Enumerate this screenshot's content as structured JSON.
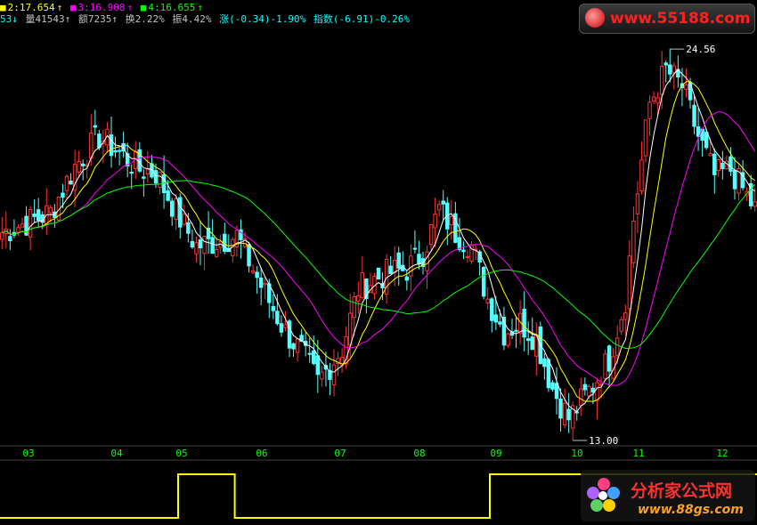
{
  "header": {
    "ma_line": [
      {
        "label": "2:17.654",
        "arrow": "↑",
        "color": "#ffff00"
      },
      {
        "label": "3:16.908",
        "arrow": "↑",
        "color": "#ff00ff"
      },
      {
        "label": "4:16.655",
        "arrow": "↑",
        "color": "#00ff00"
      }
    ],
    "info_line": [
      {
        "text": "53↓",
        "color": "#00ffff"
      },
      {
        "text": "量41543↑",
        "color": "#c0c0c0"
      },
      {
        "text": "额7235↑",
        "color": "#c0c0c0"
      },
      {
        "text": "换2.22%",
        "color": "#c0c0c0"
      },
      {
        "text": "振4.42%",
        "color": "#c0c0c0"
      },
      {
        "text": "涨(-0.34)-1.90%",
        "color": "#00ffff"
      },
      {
        "text": "指数(-6.91)-0.26%",
        "color": "#00ffff"
      }
    ]
  },
  "watermarks": {
    "top_url": "www.55188.com",
    "bottom_name": "分析家公式网",
    "bottom_url": "www.88gs.com"
  },
  "colors": {
    "up": "#ff3232",
    "down": "#54ffff",
    "ma_white": "#ffffff",
    "ma_yellow": "#ffff00",
    "ma_magenta": "#ff00ff",
    "ma_green": "#00ff00",
    "axis_label": "#00ff00",
    "indicator": "#ffff00"
  },
  "chart_data": {
    "type": "candlestick",
    "y_range": [
      12.6,
      25.2
    ],
    "months": [
      "03",
      "04",
      "05",
      "06",
      "07",
      "08",
      "09",
      "10",
      "11",
      "12"
    ],
    "annotations": {
      "high": "24.56",
      "low": "13.00"
    },
    "price_path": [
      [
        0,
        19.0
      ],
      [
        6,
        19.3
      ],
      [
        12,
        19.6
      ],
      [
        18,
        21.0
      ],
      [
        24,
        21.9
      ],
      [
        28,
        21.5
      ],
      [
        34,
        20.9
      ],
      [
        38,
        20.8
      ],
      [
        44,
        19.4
      ],
      [
        48,
        18.6
      ],
      [
        52,
        18.7
      ],
      [
        58,
        18.9
      ],
      [
        64,
        17.4
      ],
      [
        70,
        16.0
      ],
      [
        74,
        15.4
      ],
      [
        78,
        14.5
      ],
      [
        84,
        15.5
      ],
      [
        88,
        17.3
      ],
      [
        92,
        17.6
      ],
      [
        96,
        17.8
      ],
      [
        100,
        17.9
      ],
      [
        104,
        18.4
      ],
      [
        108,
        19.7
      ],
      [
        112,
        19.0
      ],
      [
        116,
        18.6
      ],
      [
        120,
        17.0
      ],
      [
        124,
        16.0
      ],
      [
        128,
        16.3
      ],
      [
        132,
        15.8
      ],
      [
        136,
        14.3
      ],
      [
        140,
        13.4
      ],
      [
        146,
        14.4
      ],
      [
        150,
        15.2
      ],
      [
        154,
        17.0
      ],
      [
        156,
        19.4
      ],
      [
        160,
        22.9
      ],
      [
        164,
        23.9
      ],
      [
        168,
        23.4
      ],
      [
        172,
        21.9
      ],
      [
        176,
        20.7
      ],
      [
        180,
        20.9
      ],
      [
        186,
        19.7
      ]
    ],
    "ma_periods": [
      5,
      10,
      20,
      40
    ],
    "indicator": {
      "type": "step",
      "levels": [
        0,
        1
      ],
      "segments": [
        [
          0,
          43,
          0
        ],
        [
          44,
          57,
          1
        ],
        [
          58,
          120,
          0
        ],
        [
          121,
          186,
          1
        ]
      ]
    }
  }
}
